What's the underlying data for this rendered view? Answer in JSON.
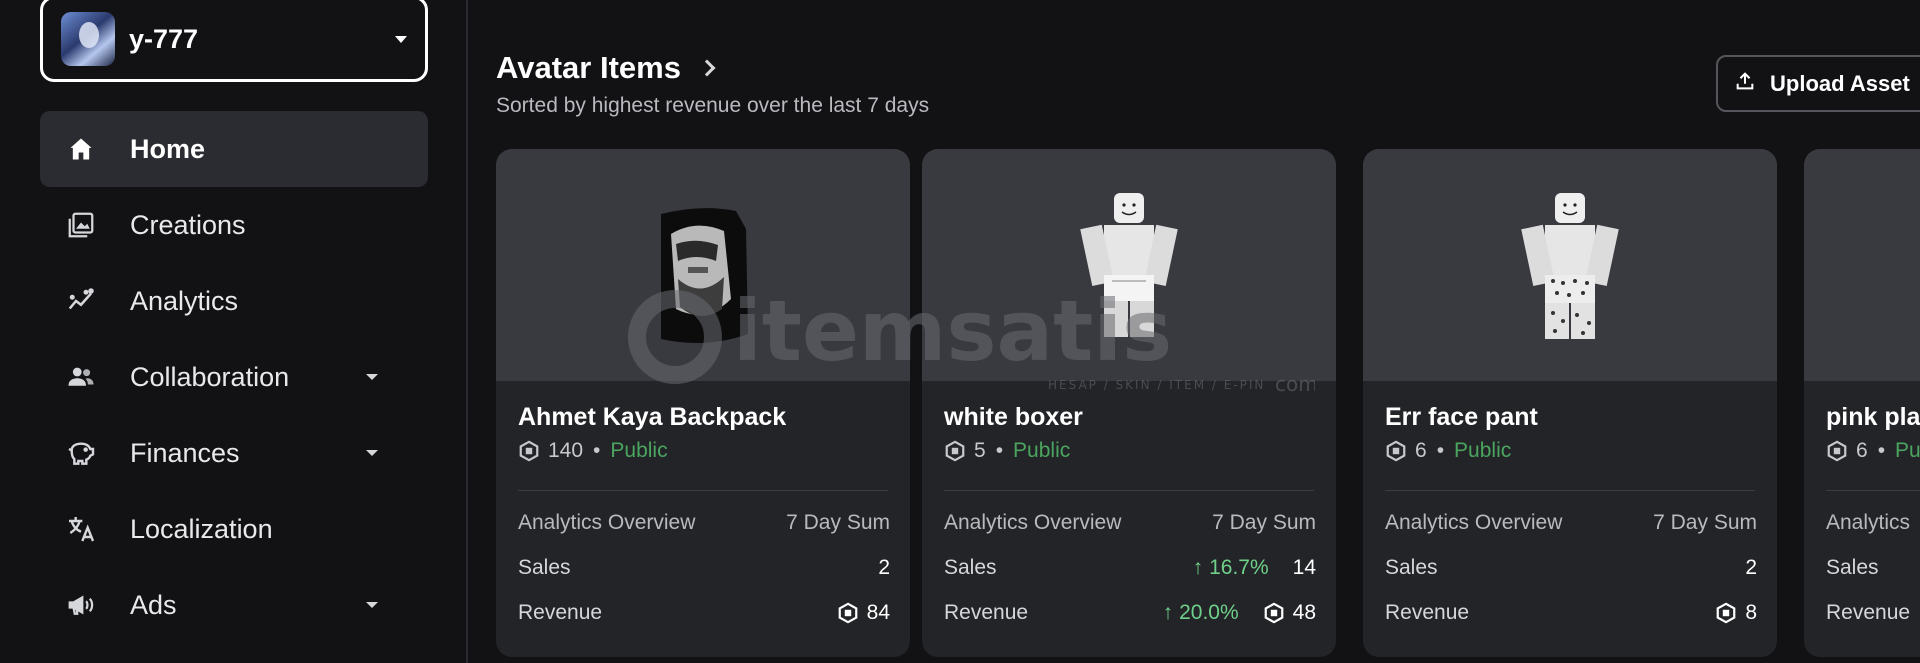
{
  "user": {
    "name": "y-777"
  },
  "nav": [
    {
      "key": "home",
      "label": "Home",
      "icon": "home-icon",
      "active": true,
      "has_caret": false
    },
    {
      "key": "creations",
      "label": "Creations",
      "icon": "gallery-icon",
      "active": false,
      "has_caret": false
    },
    {
      "key": "analytics",
      "label": "Analytics",
      "icon": "analytics-icon",
      "active": false,
      "has_caret": false
    },
    {
      "key": "collaboration",
      "label": "Collaboration",
      "icon": "people-icon",
      "active": false,
      "has_caret": true
    },
    {
      "key": "finances",
      "label": "Finances",
      "icon": "piggy-bank-icon",
      "active": false,
      "has_caret": true
    },
    {
      "key": "localization",
      "label": "Localization",
      "icon": "translate-icon",
      "active": false,
      "has_caret": false
    },
    {
      "key": "ads",
      "label": "Ads",
      "icon": "megaphone-icon",
      "active": false,
      "has_caret": true
    }
  ],
  "main": {
    "title": "Avatar Items",
    "subtitle": "Sorted by highest revenue over the last 7 days",
    "upload_label": "Upload Asset"
  },
  "items": [
    {
      "name": "Ahmet Kaya Backpack",
      "price": "140",
      "status": "Public",
      "overview_label": "Analytics Overview",
      "sum_label": "7 Day Sum",
      "sales_label": "Sales",
      "sales": "2",
      "sales_trend": "",
      "revenue_label": "Revenue",
      "revenue": "84",
      "revenue_trend": ""
    },
    {
      "name": "white boxer",
      "price": "5",
      "status": "Public",
      "overview_label": "Analytics Overview",
      "sum_label": "7 Day Sum",
      "sales_label": "Sales",
      "sales": "14",
      "sales_trend": "16.7%",
      "revenue_label": "Revenue",
      "revenue": "48",
      "revenue_trend": "20.0%"
    },
    {
      "name": "Err face pant",
      "price": "6",
      "status": "Public",
      "overview_label": "Analytics Overview",
      "sum_label": "7 Day Sum",
      "sales_label": "Sales",
      "sales": "2",
      "sales_trend": "",
      "revenue_label": "Revenue",
      "revenue": "8",
      "revenue_trend": ""
    },
    {
      "name": "pink pla",
      "price": "6",
      "status": "Pu",
      "overview_label": "Analytics",
      "sum_label": "",
      "sales_label": "Sales",
      "sales": "",
      "sales_trend": "",
      "revenue_label": "Revenue",
      "revenue": "",
      "revenue_trend": ""
    }
  ],
  "watermark": {
    "brand": "itemsatis",
    "tagline": "HESAP / SKIN / ITEM / E-PIN",
    "suffix": "com"
  },
  "colors": {
    "public": "#4aa55f",
    "trend_up": "#6fd08a",
    "active_nav_bg": "#2b2c31"
  }
}
